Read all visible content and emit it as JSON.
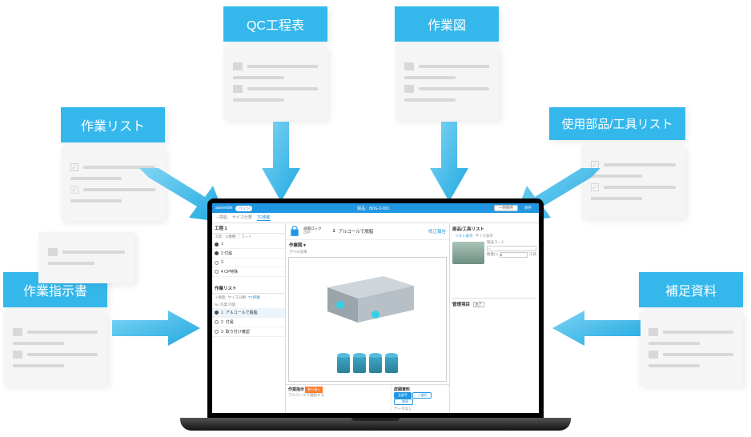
{
  "cards": {
    "qc": {
      "label": "QC工程表"
    },
    "diagram": {
      "label": "作業図"
    },
    "tasklist": {
      "label": "作業リスト"
    },
    "parts": {
      "label": "使用部品/工具リスト"
    },
    "instr": {
      "label": "作業指示書"
    },
    "suppl": {
      "label": "補足資料"
    }
  },
  "app": {
    "brand": "assemble",
    "badge": "バッジ",
    "product_label": "製品：BDG-3-001",
    "btn_pause": "一時保存",
    "btn_save": "保存",
    "tabs": {
      "a": "－樹脂",
      "b": "サイズ分類",
      "c": "TC移動"
    },
    "left": {
      "panel1": "工程 1",
      "sub1": "工程：1/機種 ▢ コート",
      "rows": [
        "1",
        "2  付属",
        "3",
        "4  CP特殊"
      ],
      "panel2": "作業リスト",
      "chip_a": "＋樹脂",
      "chip_b": "サイズ分類",
      "chip_c": "TC移動",
      "cols": "No  作業 内容",
      "task1_no": "1",
      "task1": "アルコールで脱脂",
      "task2_no": "2",
      "task2": "付属",
      "task3_no": "3",
      "task3": "取り付け確認"
    },
    "mid": {
      "lock_label": "画面ロック",
      "lock_sub": "OFF",
      "title_no": "1",
      "title": "アルコールで脱脂",
      "fix_btn": "修正報告",
      "viewer_title": "作業図 ▾",
      "viewer_sub": "ラベル効果",
      "bot_left_h": "作業指示",
      "bot_left_tag": "取り扱い",
      "bot_left_txt": "アルコールで脱脂する",
      "bot_right_h": "詳細資料",
      "tab_all": "全部手",
      "tab_part": "＋選択",
      "tab_link": "→関連",
      "no_data": "データなし"
    },
    "right": {
      "h": "部品/工具リスト",
      "chips_a": "リスト表示",
      "chips_b": "サイズ表示",
      "code_label": "製品コード",
      "code_ph": "－",
      "qty_label": "数量(*)",
      "qty_val": "0",
      "unit": "工具",
      "mgmt_h": "管理項目",
      "mgmt_chk": "完了"
    }
  }
}
